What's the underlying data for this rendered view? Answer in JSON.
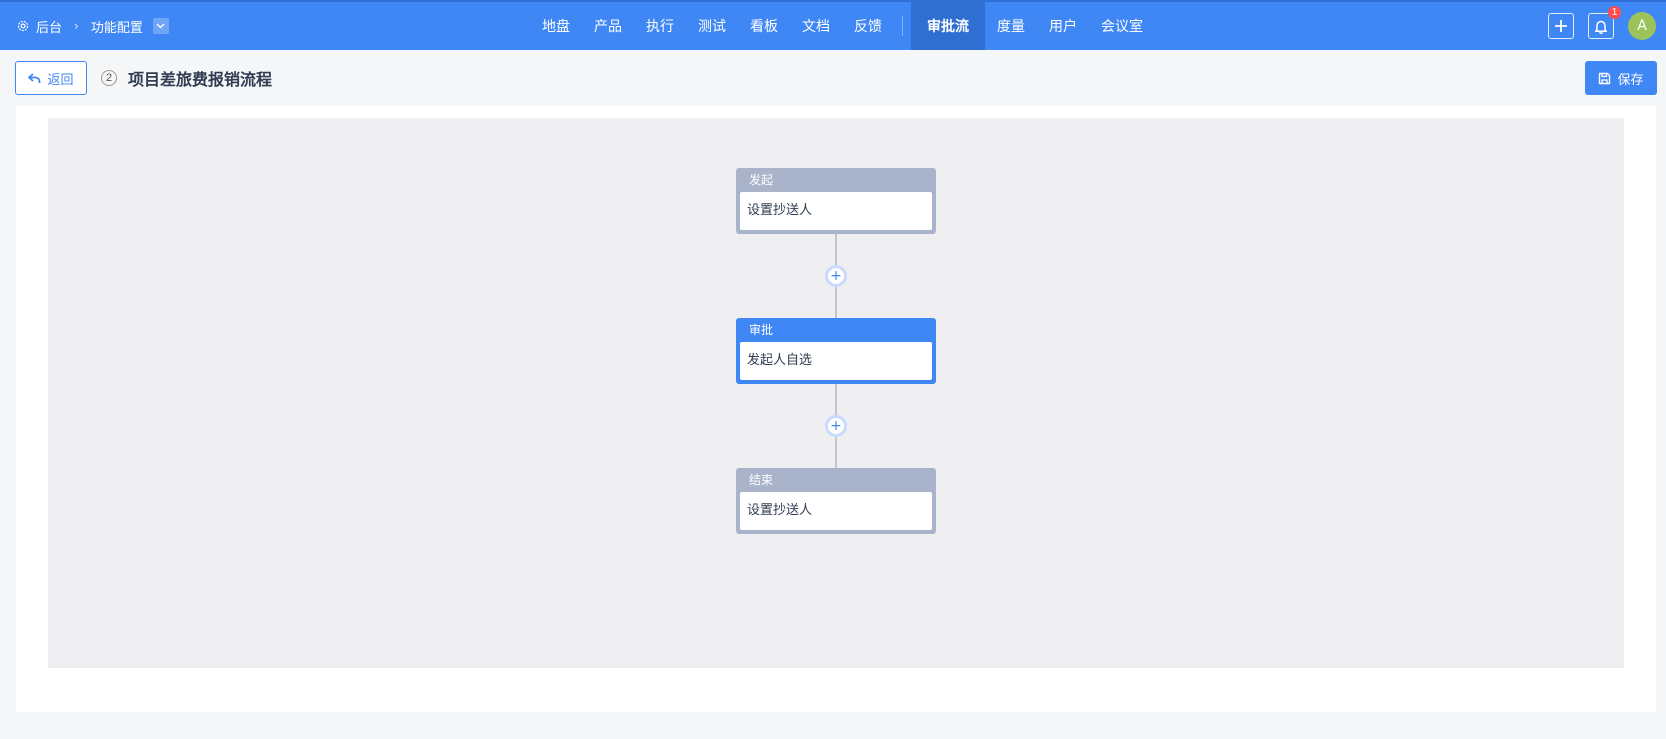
{
  "header": {
    "breadcrumb": {
      "root": "后台",
      "current": "功能配置"
    },
    "nav": [
      {
        "label": "地盘"
      },
      {
        "label": "产品"
      },
      {
        "label": "执行"
      },
      {
        "label": "测试"
      },
      {
        "label": "看板"
      },
      {
        "label": "文档"
      },
      {
        "label": "反馈"
      },
      {
        "label": "审批流",
        "active": true
      },
      {
        "label": "度量"
      },
      {
        "label": "用户"
      },
      {
        "label": "会议室"
      }
    ],
    "notification_count": "1",
    "avatar_letter": "A"
  },
  "toolbar": {
    "back_label": "返回",
    "step_number": "2",
    "title": "项目差旅费报销流程",
    "save_label": "保存"
  },
  "flow": {
    "nodes": [
      {
        "type": "发起",
        "text": "设置抄送人",
        "color": "#a9b4cb"
      },
      {
        "type": "审批",
        "text": "发起人自选",
        "color": "#3f87f5"
      },
      {
        "type": "结束",
        "text": "设置抄送人",
        "color": "#a9b4cb"
      }
    ],
    "add_symbol": "+"
  },
  "colors": {
    "primary": "#3f87f5",
    "nav_active": "#2e6fd1",
    "canvas_bg": "#efeff1",
    "badge": "#ff4d4f",
    "avatar": "#9cc25a"
  }
}
